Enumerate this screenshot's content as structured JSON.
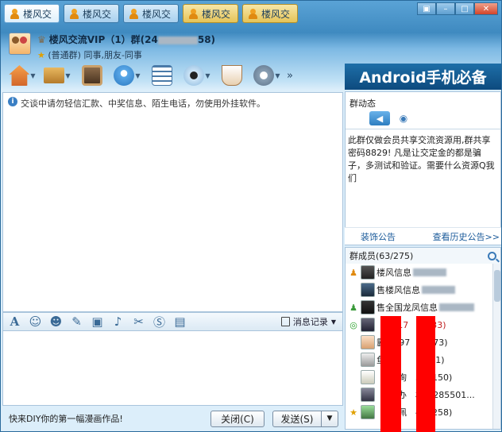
{
  "tabs": [
    {
      "label": "楼风交"
    },
    {
      "label": "楼风交"
    },
    {
      "label": "楼风交"
    },
    {
      "label": "楼风交"
    },
    {
      "label": "楼风交"
    }
  ],
  "group": {
    "name": "楼风交流VIP（1）群(24",
    "name_suffix": "58)",
    "subtitle": "(普通群) 同事,朋友-同事"
  },
  "banner_text": "Android手机必备",
  "notice": "交谈中请勿轻信汇款、中奖信息、陌生电话，勿使用外挂软件。",
  "history_label": "消息记录",
  "bottom": {
    "diy": "快来DIY你的第一幅漫画作品!",
    "close": "关闭(C)",
    "send": "发送(S)"
  },
  "right": {
    "title": "群动态",
    "announcement": "此群仅做会员共享交流资源用,群共享密码8829! 凡是让交定金的都是骗子，多测试和验证。需要什么资源Q我们",
    "decorate_link": "装饰公告",
    "history_link": "查看历史公告>>"
  },
  "members": {
    "header": "群成员(63/275)",
    "list": [
      {
        "name": "楼风信息",
        "suffix": "",
        "role": "owner"
      },
      {
        "name": "售楼风信息",
        "suffix": "",
        "role": "none"
      },
      {
        "name": "售全国龙凤信息",
        "suffix": "",
        "role": "admin"
      },
      {
        "name": "",
        "suffix": "(17　　733)",
        "role": "vip"
      },
      {
        "name": "霸",
        "suffix": "天(97　　573)",
        "role": "none"
      },
      {
        "name": "鱼",
        "suffix": "(24　　7041)",
        "role": "none"
      },
      {
        "name": "",
        "suffix": "咨询　320150)",
        "role": "none"
      },
      {
        "name": "",
        "suffix": "华办　材(3285501...",
        "role": "none"
      },
      {
        "name": "",
        "suffix": "玉佩　472258)",
        "role": "star"
      }
    ]
  }
}
